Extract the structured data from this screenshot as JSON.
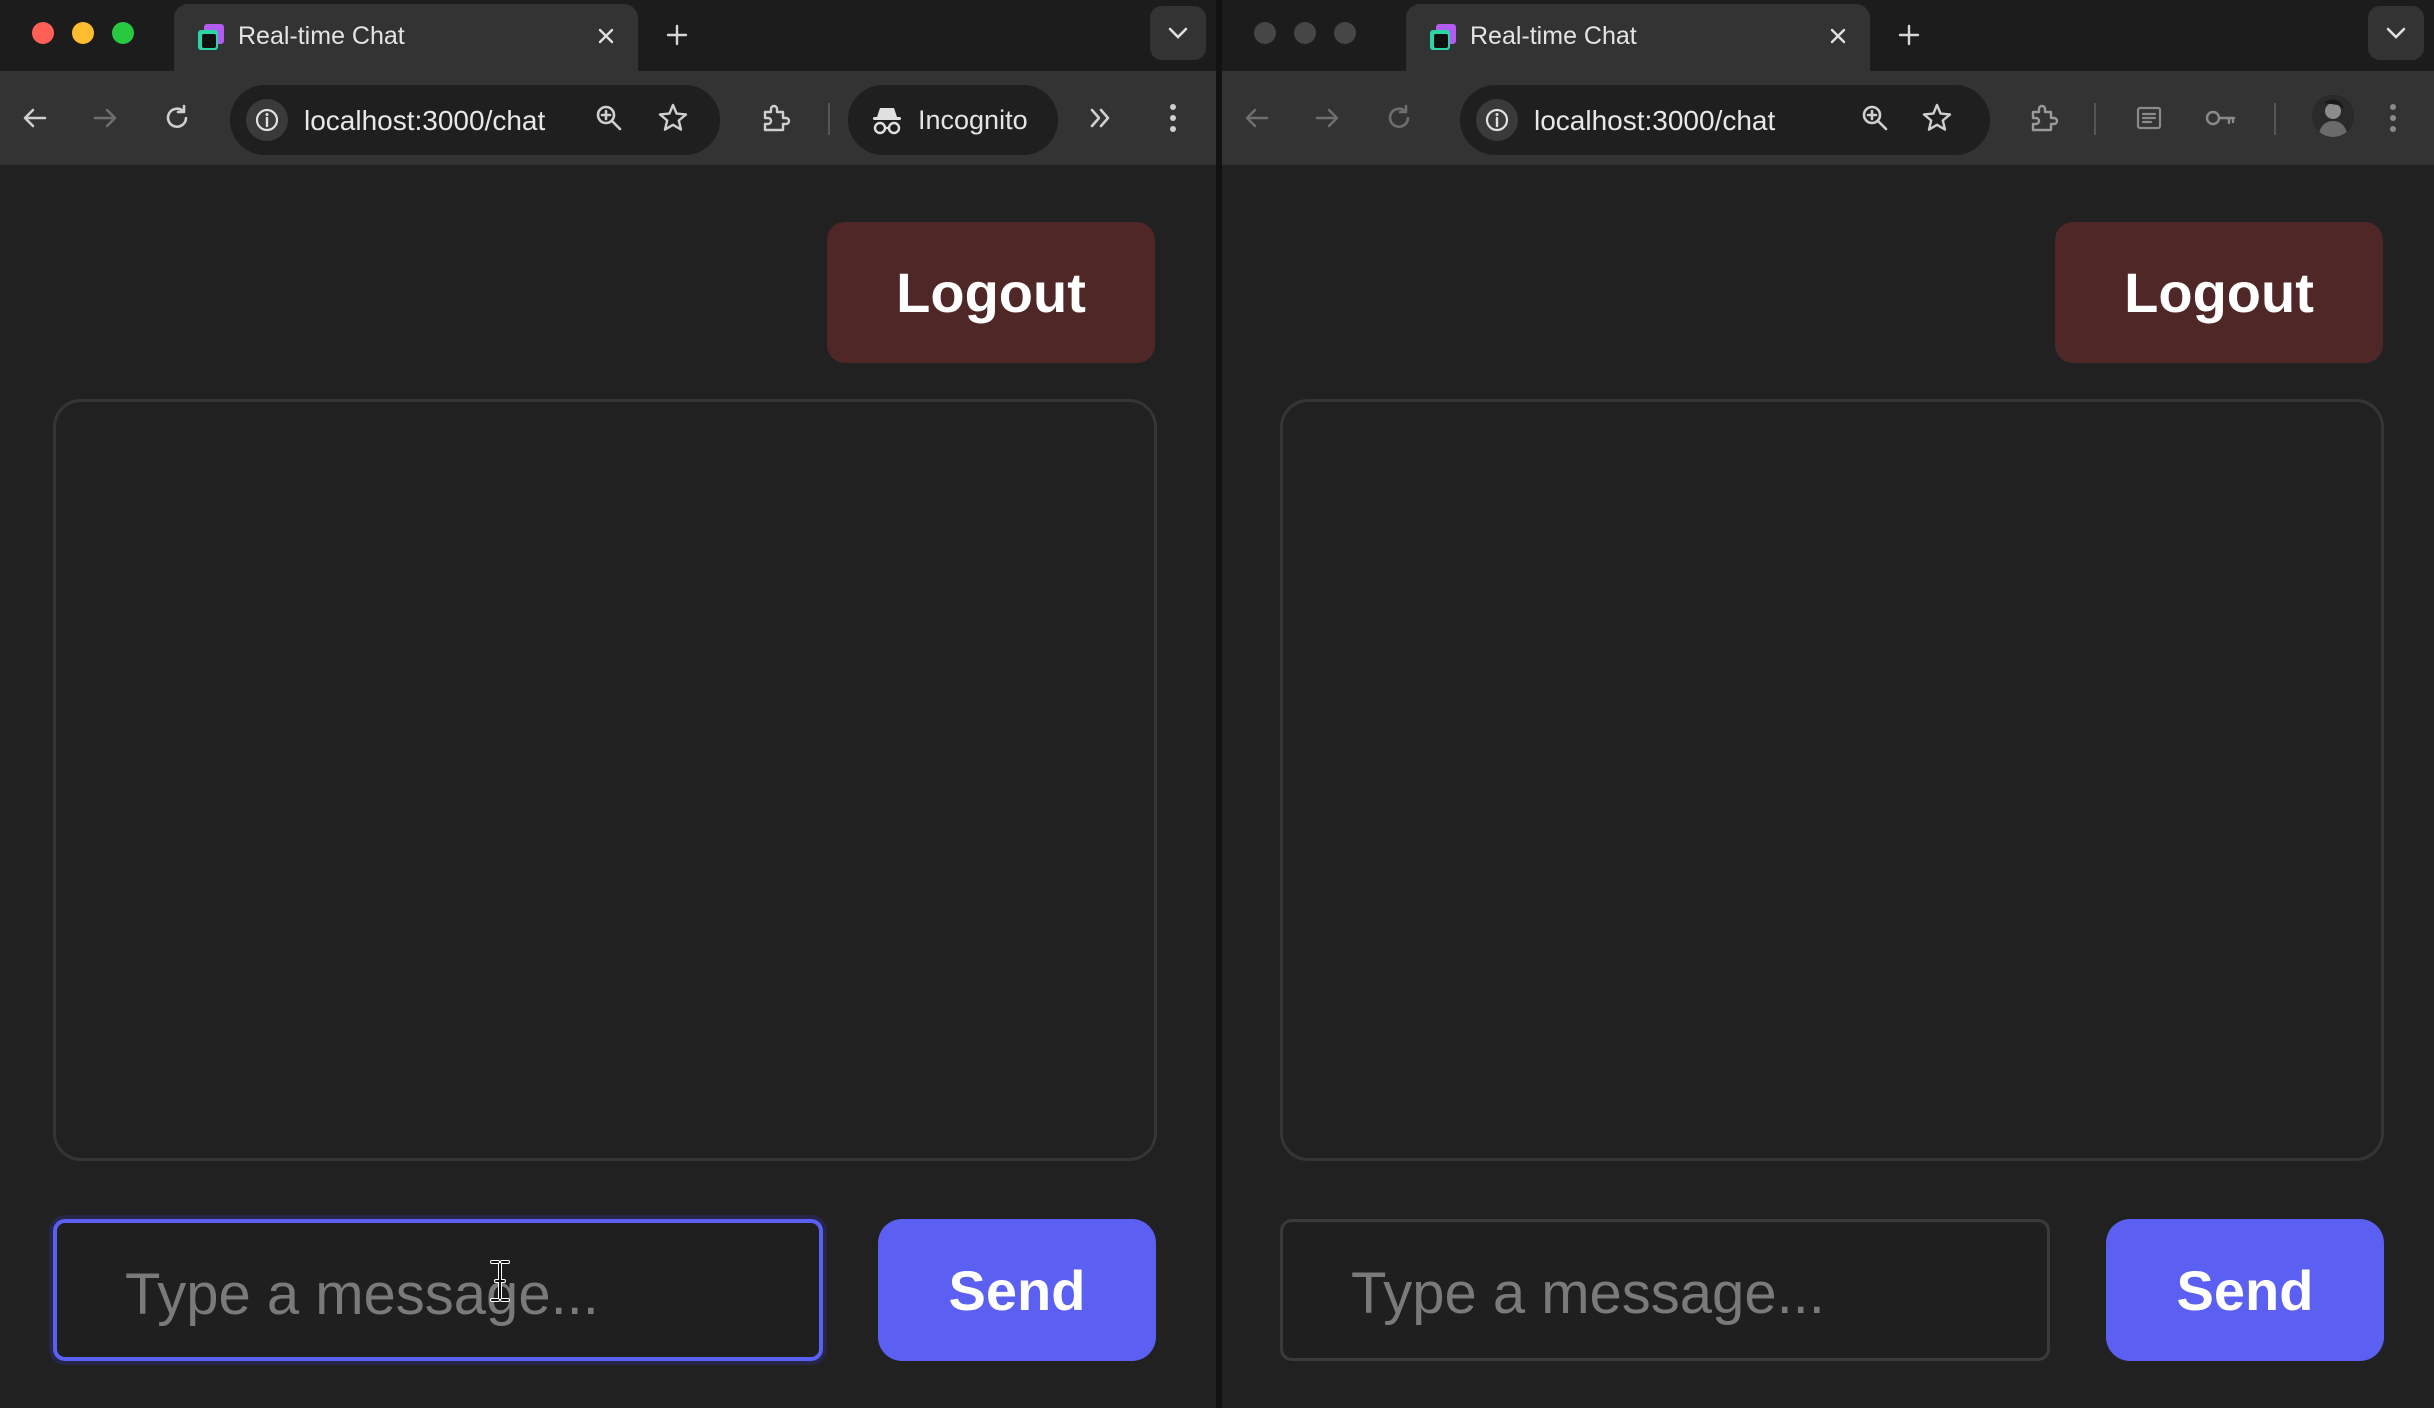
{
  "colors": {
    "logout_bg": "#4f2727",
    "send_bg": "#5b5ff2",
    "focus_ring": "#5b5ff2",
    "page_bg": "#212121",
    "chrome_toolbar": "#333334"
  },
  "windows": [
    {
      "id": "left",
      "mode": "incognito",
      "tab": {
        "title": "Real-time Chat",
        "icon": "app-favicon"
      },
      "toolbar": {
        "url": "localhost:3000/chat",
        "incognito_label": "Incognito",
        "icons": [
          "back-icon",
          "forward-icon",
          "reload-icon",
          "info-icon",
          "zoom-icon",
          "bookmark-star-icon",
          "extensions-icon",
          "incognito-icon",
          "more-tools-icon",
          "kebab-menu-icon"
        ]
      },
      "page": {
        "logout_label": "Logout",
        "message_placeholder": "Type a message...",
        "send_label": "Send",
        "input_focused": true
      }
    },
    {
      "id": "right",
      "mode": "normal",
      "tab": {
        "title": "Real-time Chat",
        "icon": "app-favicon"
      },
      "toolbar": {
        "url": "localhost:3000/chat",
        "icons": [
          "back-icon",
          "forward-icon",
          "reload-icon",
          "info-icon",
          "zoom-icon",
          "bookmark-star-icon",
          "extensions-icon",
          "reading-list-icon",
          "password-key-icon",
          "profile-avatar",
          "kebab-menu-icon"
        ]
      },
      "page": {
        "logout_label": "Logout",
        "message_placeholder": "Type a message...",
        "send_label": "Send",
        "input_focused": false
      }
    }
  ]
}
